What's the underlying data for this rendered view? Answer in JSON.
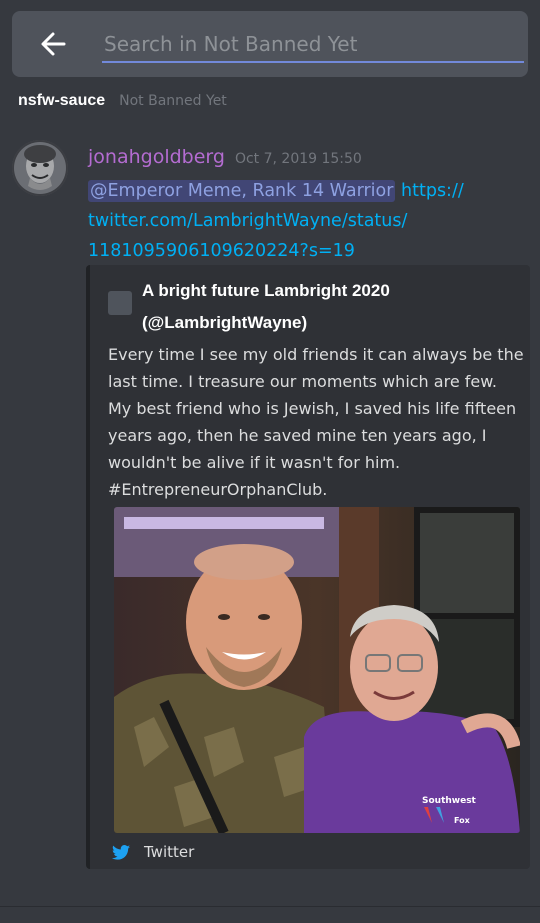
{
  "search": {
    "placeholder": "Search in Not Banned Yet",
    "value": ""
  },
  "channel": {
    "name": "nsfw-sauce",
    "server": "Not Banned Yet"
  },
  "message": {
    "username": "jonahgoldberg",
    "timestamp": "Oct 7, 2019 15:50",
    "mention": "@Emperor Meme, Rank 14 Warrior",
    "link_text": "https://twitter.com/LambrightWayne/status/1181095906109620224?s=19",
    "link_line1": "https://",
    "link_line2": "twitter.com/LambrightWayne/status/",
    "link_line3": "1181095906109620224?s=19"
  },
  "embed": {
    "author_line1": "A bright future Lambright 2020",
    "author_line2": "(@LambrightWayne)",
    "description": "Every time I see my old friends it can always be the last time. I treasure our moments which are few.  My best friend who is Jewish, I saved his life fifteen years ago, then he saved mine ten years ago, I wouldn't be alive if it wasn't for him.  #EntrepreneurOrphanClub.",
    "shirt_text": "Southwest",
    "shirt_text2": "Fox",
    "footer": "Twitter"
  },
  "colors": {
    "background": "#36393f",
    "embed_bg": "#2f3136",
    "link": "#00b0f4",
    "mention_bg": "#414675",
    "username": "#b46cd1",
    "accent": "#7289da"
  },
  "icons": [
    "back-arrow-icon",
    "twitter-bird-icon",
    "embed-author-icon"
  ]
}
